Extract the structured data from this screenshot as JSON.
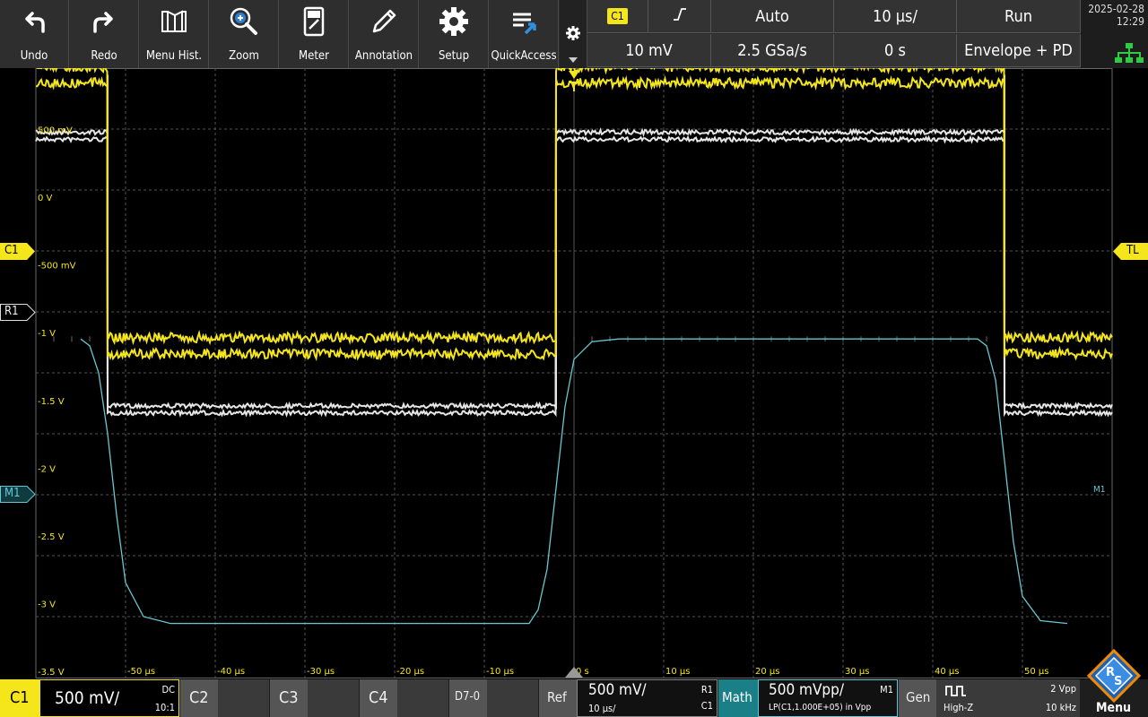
{
  "toolbar": {
    "buttons": [
      {
        "label": "Undo",
        "icon": "undo-icon"
      },
      {
        "label": "Redo",
        "icon": "redo-icon"
      },
      {
        "label": "Menu Hist.",
        "icon": "menu-history-icon"
      },
      {
        "label": "Zoom",
        "icon": "zoom-icon"
      },
      {
        "label": "Meter",
        "icon": "meter-icon"
      },
      {
        "label": "Annotation",
        "icon": "annotation-pencil-icon"
      },
      {
        "label": "Setup",
        "icon": "gear-icon"
      },
      {
        "label": "QuickAccess",
        "icon": "quick-access-icon"
      }
    ]
  },
  "acquisition": {
    "trigger_source": "C1",
    "trigger_slope_symbol": "⨍",
    "trigger_mode": "Auto",
    "time_scale": "10 µs/",
    "run_state": "Run",
    "trigger_level": "10 mV",
    "sample_rate": "2.5 GSa/s",
    "trigger_position": "0 s",
    "acq_mode": "Envelope + PD"
  },
  "status": {
    "date": "2025-02-28",
    "time": "12:29"
  },
  "markers": {
    "c1": "C1",
    "r1": "R1",
    "m1": "M1",
    "tl": "TL",
    "m1_right": "M1"
  },
  "y_labels": [
    "500 mV",
    "0 V",
    "-500 mV",
    "-1 V",
    "-1.5 V",
    "-2 V",
    "-2.5 V",
    "-3 V",
    "-3.5 V"
  ],
  "x_labels": [
    "-50 µs",
    "-40 µs",
    "-30 µs",
    "-20 µs",
    "-10 µs",
    "0 s",
    "10 µs",
    "20 µs",
    "30 µs",
    "40 µs",
    "50 µs"
  ],
  "colors": {
    "c1": "#f4e61a",
    "ref": "#e6e6e6",
    "math": "#67c7d2",
    "grid": "#555555",
    "toolbar": "#2e2e2e"
  },
  "chart_data": {
    "type": "line",
    "xlabel": "",
    "ylabel": "",
    "xlim": [
      -60,
      60
    ],
    "ylim": [
      -3.5,
      1.0
    ],
    "x_unit": "µs",
    "y_unit": "V",
    "series": [
      {
        "name": "C1",
        "x": [
          -60,
          -52,
          -52,
          -2,
          -2,
          48,
          48,
          60
        ],
        "y": [
          0.95,
          0.95,
          -1.05,
          -1.05,
          0.95,
          0.95,
          -1.05,
          -1.05
        ]
      },
      {
        "name": "R1",
        "x": [
          -60,
          -52,
          -52,
          -2,
          -2,
          48,
          48,
          60
        ],
        "y": [
          0.5,
          0.5,
          -1.52,
          -1.52,
          0.5,
          0.5,
          -1.52,
          -1.52
        ]
      },
      {
        "name": "M1",
        "x": [
          -55,
          -54,
          -53,
          -52,
          -51,
          -50,
          -48,
          -45,
          -5,
          -4,
          -3,
          -2,
          -1,
          0,
          2,
          5,
          45,
          46,
          47,
          48,
          49,
          50,
          52,
          55
        ],
        "y": [
          -1.0,
          -1.05,
          -1.25,
          -1.7,
          -2.3,
          -2.8,
          -3.05,
          -3.1,
          -3.1,
          -3.0,
          -2.7,
          -2.1,
          -1.5,
          -1.15,
          -1.02,
          -1.0,
          -1.0,
          -1.05,
          -1.3,
          -1.9,
          -2.5,
          -2.9,
          -3.08,
          -3.1
        ]
      }
    ]
  },
  "bottom": {
    "c1_label": "C1",
    "c1_scale": "500 mV/",
    "c1_coupling": "DC",
    "c1_probe": "10:1",
    "c2": "C2",
    "c3": "C3",
    "c4": "C4",
    "d70": "D7-0",
    "ref_label": "Ref",
    "ref_scale": "500 mV/",
    "ref_time": "10 µs/",
    "ref_name": "R1",
    "ref_src": "C1",
    "math_label": "Math",
    "math_scale": "500 mVpp/",
    "math_name": "M1",
    "math_expr": "LP(C1,1.000E+05) in Vpp",
    "gen_label": "Gen",
    "gen_imp": "High-Z",
    "gen_amp": "2 Vpp",
    "gen_freq": "10 kHz",
    "menu_label": "Menu"
  }
}
